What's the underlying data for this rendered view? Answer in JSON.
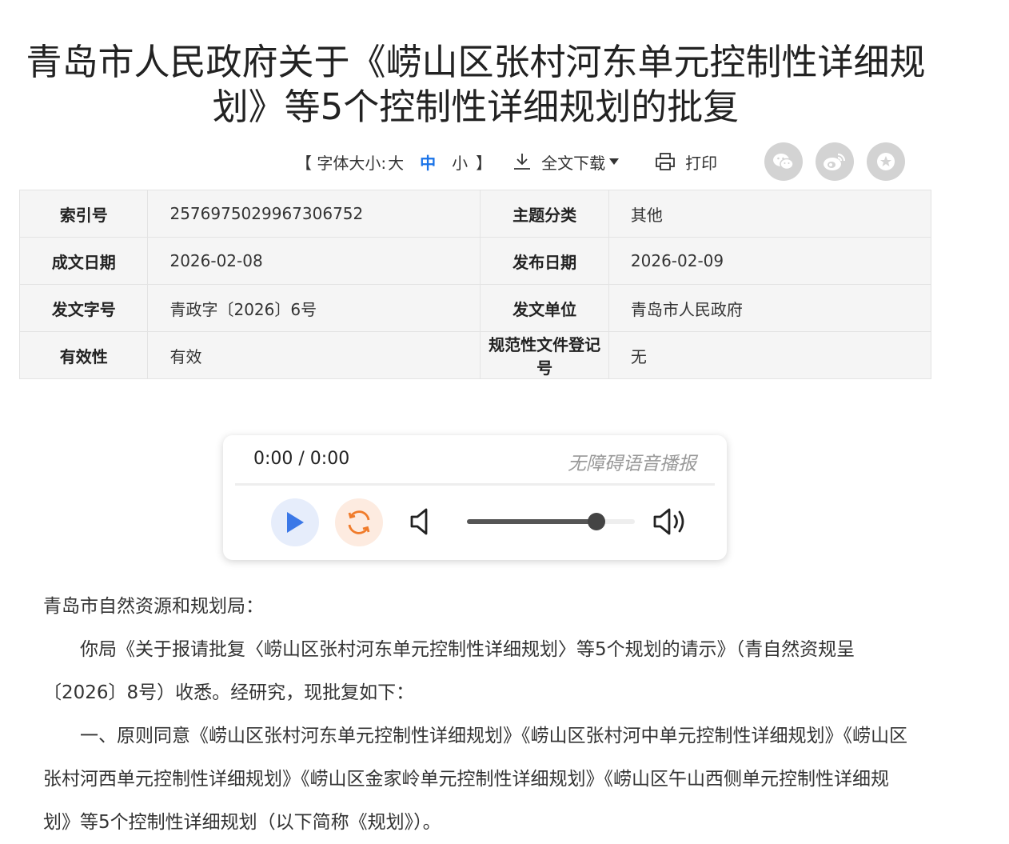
{
  "title": "青岛市人民政府关于《崂山区张村河东单元控制性详细规划》等5个控制性详细规划的批复",
  "toolbar": {
    "font_size_label": "【 字体大小: ",
    "font_large": "大",
    "font_medium": "中",
    "font_small": "小",
    "bracket_close": "】",
    "download_label": "全文下载",
    "print_label": "打印",
    "share_icons": [
      "wechat-icon",
      "weibo-icon",
      "favorite-icon"
    ]
  },
  "meta": {
    "rows": [
      {
        "k1": "索引号",
        "v1": "2576975029967306752",
        "k2": "主题分类",
        "v2": "其他"
      },
      {
        "k1": "成文日期",
        "v1": "2026-02-08",
        "k2": "发布日期",
        "v2": "2026-02-09"
      },
      {
        "k1": "发文字号",
        "v1": "青政字〔2026〕6号",
        "k2": "发文单位",
        "v2": "青岛市人民政府"
      },
      {
        "k1": "有效性",
        "v1": "有效",
        "k2": "规范性文件登记号",
        "v2": "无"
      }
    ]
  },
  "player": {
    "time": "0:00 / 0:00",
    "a11y_label": "无障碍语音播报",
    "volume": 0.77
  },
  "body": {
    "p1": "青岛市自然资源和规划局：",
    "p2": "你局《关于报请批复〈崂山区张村河东单元控制性详细规划〉等5个规划的请示》（青自然资规呈〔2026〕8号）收悉。经研究，现批复如下：",
    "p3": "一、原则同意《崂山区张村河东单元控制性详细规划》《崂山区张村河中单元控制性详细规划》《崂山区张村河西单元控制性详细规划》《崂山区金家岭单元控制性详细规划》《崂山区午山西侧单元控制性详细规划》等5个控制性详细规划（以下简称《规划》）。"
  },
  "colors": {
    "accent": "#1a73e8",
    "play": "#3b78e7",
    "loop": "#f07b2a",
    "table_bg": "#f5f5f5"
  }
}
